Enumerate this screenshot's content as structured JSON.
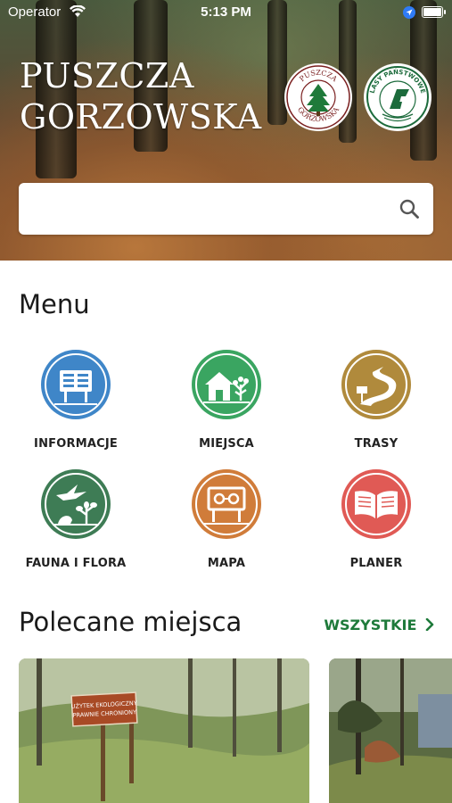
{
  "status_bar": {
    "carrier": "Operator",
    "time": "5:13 PM"
  },
  "header": {
    "title_line1": "PUSZCZA",
    "title_line2": "GORZOWSKA",
    "logo1_text_top": "PUSZCZA",
    "logo1_text_bottom": "GORZOWSKA",
    "logo2_text": "LASY PAŃSTWOWE"
  },
  "search": {
    "value": "",
    "placeholder": ""
  },
  "menu": {
    "title": "Menu",
    "items": [
      {
        "label": "INFORMACJE",
        "color": "#3f86c8",
        "icon": "info-board-icon"
      },
      {
        "label": "MIEJSCA",
        "color": "#3aa561",
        "icon": "house-tree-icon"
      },
      {
        "label": "TRASY",
        "color": "#b08a3c",
        "icon": "trail-path-icon"
      },
      {
        "label": "FAUNA I FLORA",
        "color": "#3e7c55",
        "icon": "bird-plant-icon"
      },
      {
        "label": "MAPA",
        "color": "#d07c3a",
        "icon": "map-sign-icon"
      },
      {
        "label": "PLANER",
        "color": "#e05a55",
        "icon": "open-book-icon"
      }
    ]
  },
  "featured": {
    "title": "Polecane miejsca",
    "see_all": "WSZYSTKIE",
    "card1_sign_line1": "UŻYTEK EKOLOGICZNY",
    "card1_sign_line2": "PRAWNIE CHRONIONY"
  }
}
